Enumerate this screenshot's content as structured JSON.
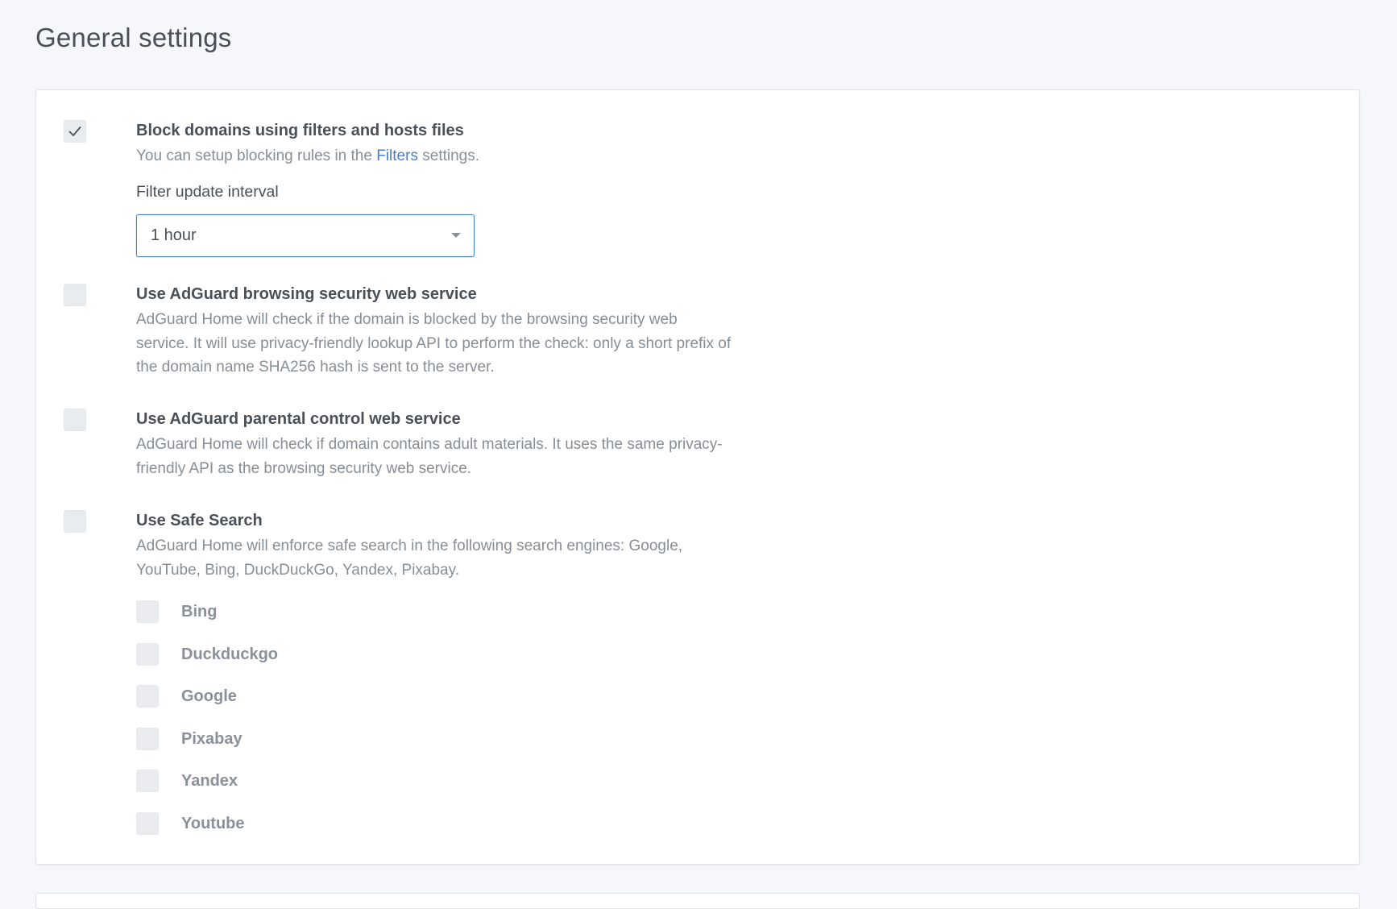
{
  "page": {
    "title": "General settings"
  },
  "options": {
    "block_domains": {
      "title": "Block domains using filters and hosts files",
      "desc_before": "You can setup blocking rules in the ",
      "desc_link": "Filters",
      "desc_after": " settings.",
      "checked": true,
      "interval_label": "Filter update interval",
      "interval_value": "1 hour"
    },
    "browsing_security": {
      "title": "Use AdGuard browsing security web service",
      "desc": "AdGuard Home will check if the domain is blocked by the browsing security web service. It will use privacy-friendly lookup API to perform the check: only a short prefix of the domain name SHA256 hash is sent to the server.",
      "checked": false
    },
    "parental_control": {
      "title": "Use AdGuard parental control web service",
      "desc": "AdGuard Home will check if domain contains adult materials. It uses the same privacy-friendly API as the browsing security web service.",
      "checked": false
    },
    "safe_search": {
      "title": "Use Safe Search",
      "desc": "AdGuard Home will enforce safe search in the following search engines: Google, YouTube, Bing, DuckDuckGo, Yandex, Pixabay.",
      "checked": false,
      "engines": [
        {
          "label": "Bing",
          "checked": false
        },
        {
          "label": "Duckduckgo",
          "checked": false
        },
        {
          "label": "Google",
          "checked": false
        },
        {
          "label": "Pixabay",
          "checked": false
        },
        {
          "label": "Yandex",
          "checked": false
        },
        {
          "label": "Youtube",
          "checked": false
        }
      ]
    }
  },
  "colors": {
    "background": "#f5f7fb",
    "card": "#ffffff",
    "link": "#467fcf",
    "checkbox": "#e9ecef",
    "muted_text": "#868e96",
    "text": "#495057"
  }
}
